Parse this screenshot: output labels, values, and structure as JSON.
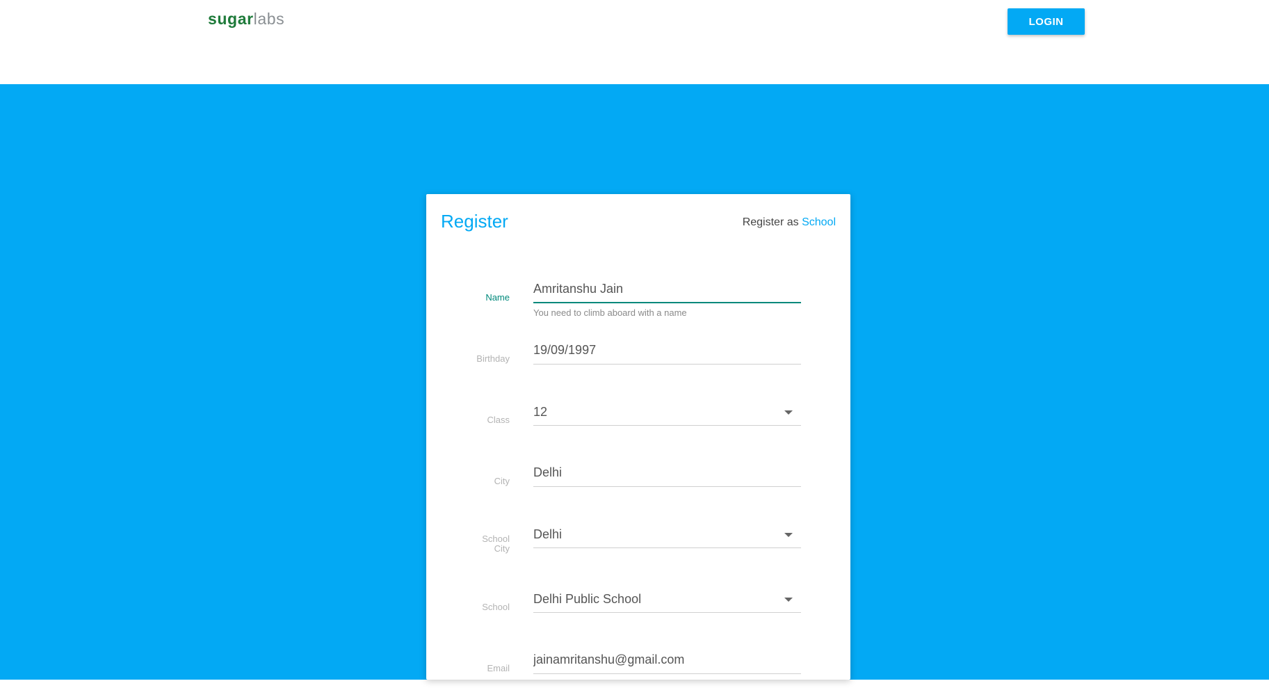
{
  "brand": {
    "logo_primary": "sugar",
    "logo_secondary": "labs"
  },
  "header": {
    "login_label": "LOGIN"
  },
  "form": {
    "title": "Register",
    "register_as_prefix": "Register as",
    "register_as_link": "School",
    "fields": {
      "name": {
        "label": "Name",
        "value": "Amritanshu Jain",
        "helper": "You need to climb aboard with a name"
      },
      "birthday": {
        "label": "Birthday",
        "value": "19/09/1997"
      },
      "class": {
        "label": "Class",
        "value": "12"
      },
      "city": {
        "label": "City",
        "value": "Delhi"
      },
      "school_city": {
        "label_line1": "School",
        "label_line2": "City",
        "value": "Delhi"
      },
      "school": {
        "label": "School",
        "value": "Delhi Public School"
      },
      "email": {
        "label": "Email",
        "value": "jainamritanshu@gmail.com"
      }
    }
  },
  "colors": {
    "accent": "#03a9f4",
    "focus": "#00897b",
    "brand_green": "#1e7a3a"
  }
}
